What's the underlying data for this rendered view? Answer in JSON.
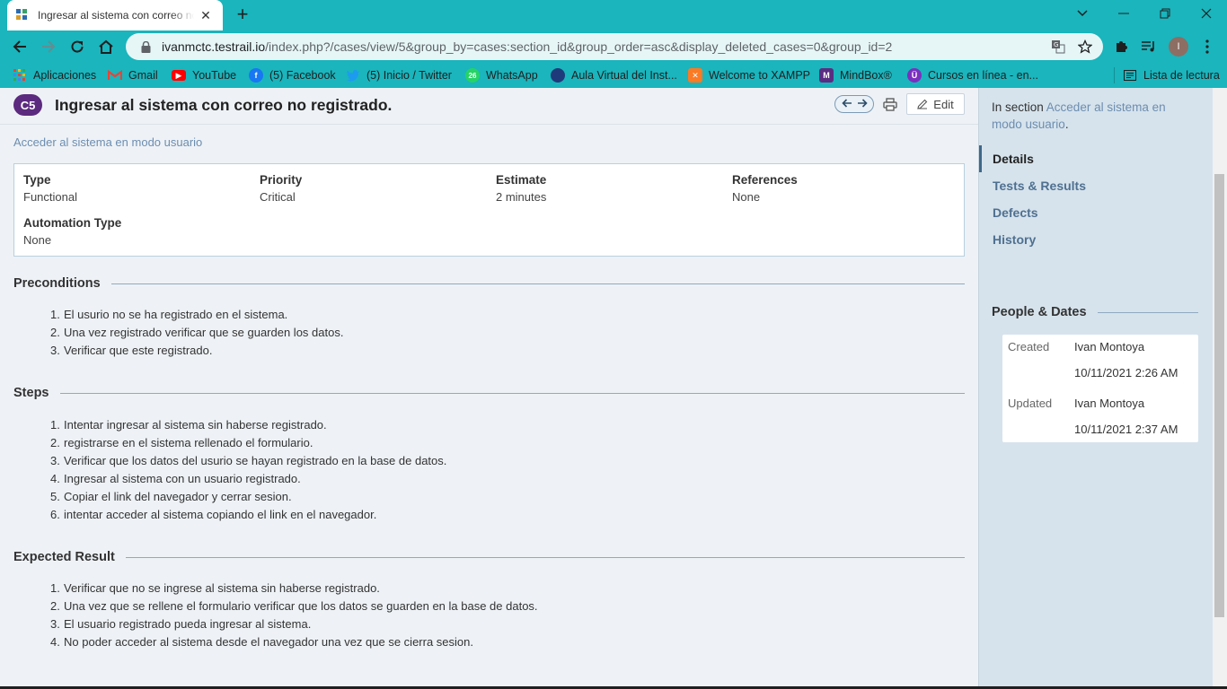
{
  "browser": {
    "tab_title": "Ingresar al sistema con correo no registrado.",
    "url_host": "ivanmctc.testrail.io",
    "url_path": "/index.php?/cases/view/5&group_by=cases:section_id&group_order=asc&display_deleted_cases=0&group_id=2",
    "profile_initial": "I",
    "bookmarks": [
      {
        "label": "Aplicaciones",
        "icon": "apps-grid-icon"
      },
      {
        "label": "Gmail",
        "icon": "gmail-icon"
      },
      {
        "label": "YouTube",
        "icon": "youtube-icon"
      },
      {
        "label": "(5) Facebook",
        "icon": "facebook-icon"
      },
      {
        "label": "(5) Inicio / Twitter",
        "icon": "twitter-icon"
      },
      {
        "label": "WhatsApp",
        "icon": "whatsapp-icon"
      },
      {
        "label": "Aula Virtual del Inst...",
        "icon": "aula-virtual-icon"
      },
      {
        "label": "Welcome to XAMPP",
        "icon": "xampp-icon"
      },
      {
        "label": "MindBox®",
        "icon": "mindbox-icon"
      },
      {
        "label": "Cursos en línea - en...",
        "icon": "cursos-icon"
      }
    ],
    "reading_list": "Lista de lectura",
    "colors": {
      "chrome": "#1ab5bd"
    }
  },
  "case": {
    "id": "C5",
    "title": "Ingresar al sistema con correo no registrado.",
    "edit_label": "Edit",
    "section_link": "Acceder al sistema en modo usuario",
    "fields": {
      "type_label": "Type",
      "type_value": "Functional",
      "priority_label": "Priority",
      "priority_value": "Critical",
      "estimate_label": "Estimate",
      "estimate_value": "2 minutes",
      "references_label": "References",
      "references_value": "None",
      "automation_label": "Automation Type",
      "automation_value": "None"
    },
    "preconditions_title": "Preconditions",
    "preconditions": [
      "El usurio no se ha registrado en el sistema.",
      "Una vez registrado verificar que se guarden los datos.",
      "Verificar que este registrado."
    ],
    "steps_title": "Steps",
    "steps": [
      "Intentar ingresar al sistema sin haberse registrado.",
      "registrarse en el sistema rellenado el formulario.",
      "Verificar que los datos del usurio se hayan registrado en la base de datos.",
      "Ingresar al sistema con un usuario registrado.",
      "Copiar el link del navegador y cerrar sesion.",
      "intentar acceder al sistema copiando el link en el navegador."
    ],
    "expected_title": "Expected Result",
    "expected": [
      "Verificar que no se ingrese al sistema sin haberse registrado.",
      "Una vez que se rellene el formulario verificar que los datos se guarden en la base de datos.",
      "El usuario registrado pueda ingresar al sistema.",
      "No poder acceder al sistema desde el navegador una vez que se cierra sesion."
    ],
    "colors": {
      "badge": "#5c2a7e",
      "link": "#6d8db0"
    }
  },
  "sidebar": {
    "in_section_prefix": "In section ",
    "in_section_link": "Acceder al sistema en modo usuario",
    "in_section_suffix": ".",
    "nav": [
      "Details",
      "Tests & Results",
      "Defects",
      "History"
    ],
    "people_dates_title": "People & Dates",
    "created_label": "Created",
    "created_by": "Ivan Montoya",
    "created_at": "10/11/2021 2:26 AM",
    "updated_label": "Updated",
    "updated_by": "Ivan Montoya",
    "updated_at": "10/11/2021 2:37 AM"
  }
}
